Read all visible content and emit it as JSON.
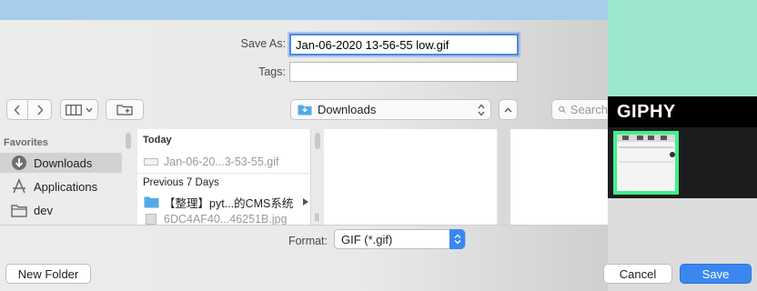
{
  "save_as": {
    "label": "Save As:",
    "value": "Jan-06-2020 13-56-55 low.gif"
  },
  "tags": {
    "label": "Tags:",
    "value": ""
  },
  "location": {
    "value": "Downloads"
  },
  "search": {
    "placeholder": "Search"
  },
  "sidebar": {
    "header": "Favorites",
    "items": [
      {
        "label": "Downloads",
        "icon": "download-circle-icon",
        "selected": true
      },
      {
        "label": "Applications",
        "icon": "applications-icon",
        "selected": false
      },
      {
        "label": "dev",
        "icon": "folder-icon",
        "selected": false
      }
    ]
  },
  "files": {
    "today_header": "Today",
    "today": [
      {
        "name": "Jan-06-20...3-53-55.gif",
        "dimmed": true
      }
    ],
    "previous_header": "Previous 7 Days",
    "previous": [
      {
        "name": "【整理】pyt...的CMS系统",
        "type": "folder",
        "dimmed": false
      },
      {
        "name": "6DC4AF40...46251B.jpg",
        "type": "file",
        "dimmed": true
      }
    ]
  },
  "format": {
    "label": "Format:",
    "value": "GIF (*.gif)"
  },
  "buttons": {
    "new_folder": "New Folder",
    "cancel": "Cancel",
    "save": "Save"
  },
  "giphy": {
    "logo": "GIPHY"
  },
  "colors": {
    "accent": "#3b87f0",
    "giphy_green": "#41ef8b",
    "folder_blue": "#52a9e8"
  }
}
